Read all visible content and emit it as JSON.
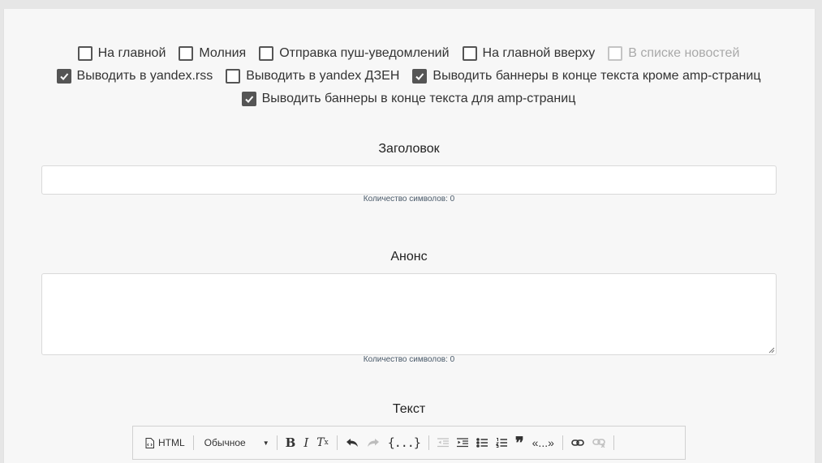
{
  "checkboxes": {
    "row1": [
      {
        "label": "На главной",
        "checked": false,
        "disabled": false
      },
      {
        "label": "Молния",
        "checked": false,
        "disabled": false
      },
      {
        "label": "Отправка пуш-уведомлений",
        "checked": false,
        "disabled": false
      },
      {
        "label": "На главной вверху",
        "checked": false,
        "disabled": false
      },
      {
        "label": "В списке новостей",
        "checked": false,
        "disabled": true
      }
    ],
    "row2": [
      {
        "label": "Выводить в yandex.rss",
        "checked": true,
        "disabled": false
      },
      {
        "label": "Выводить в yandex ДЗЕН",
        "checked": false,
        "disabled": false
      },
      {
        "label": "Выводить баннеры в конце текста кроме amp-страниц",
        "checked": true,
        "disabled": false
      }
    ],
    "row3": [
      {
        "label": "Выводить баннеры в конце текста для amp-страниц",
        "checked": true,
        "disabled": false
      }
    ]
  },
  "title_field": {
    "label": "Заголовок",
    "value": "",
    "counter": "Количество символов: 0"
  },
  "lead_field": {
    "label": "Анонс",
    "value": "",
    "counter": "Количество символов: 0"
  },
  "text_field": {
    "label": "Текст"
  },
  "editor_toolbar": {
    "html_label": "HTML",
    "format_value": "Обычное",
    "bold": "B",
    "italic": "I",
    "remove_format": "T",
    "remove_format_sub": "x",
    "code": "{...}",
    "blockquote": "❞",
    "guillemets": "«...»",
    "icons": [
      "source-icon",
      "undo-icon",
      "redo-icon",
      "outdent-icon",
      "indent-icon",
      "bulleted-list-icon",
      "numbered-list-icon",
      "blockquote-icon",
      "link-icon",
      "unlink-icon"
    ],
    "colors": {
      "enabled": "#333333",
      "disabled": "#bdbdbd"
    }
  }
}
